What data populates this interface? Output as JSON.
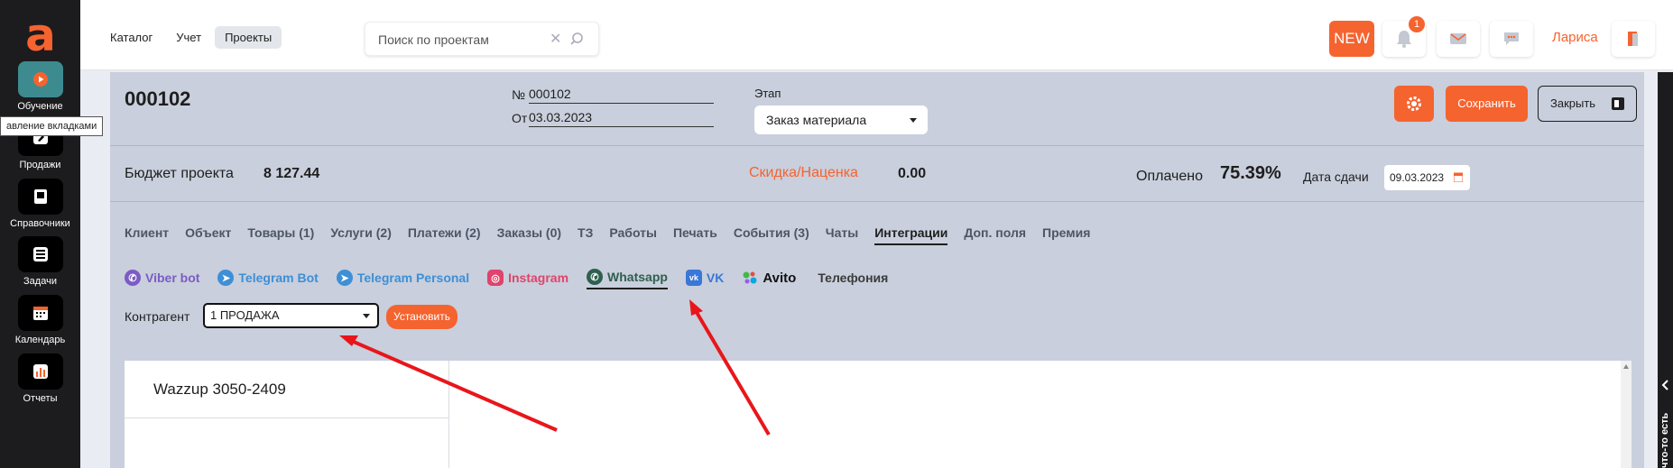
{
  "sidebar": {
    "logo": "a",
    "items": [
      {
        "label": "Обучение",
        "icon": "play-icon",
        "active": true
      },
      {
        "label": "Продажи",
        "icon": "tag-icon"
      },
      {
        "label": "Справочники",
        "icon": "book-icon"
      },
      {
        "label": "Задачи",
        "icon": "list-icon"
      },
      {
        "label": "Календарь",
        "icon": "calendar-icon"
      },
      {
        "label": "Отчеты",
        "icon": "chart-icon"
      }
    ],
    "tooltip": "авление вкладками"
  },
  "topbar": {
    "crumbs": [
      "Каталог",
      "Учет",
      "Проекты"
    ],
    "active_crumb": "Проекты",
    "search_placeholder": "Поиск по проектам",
    "new_label": "NEW",
    "notification_count": "1",
    "user_name": "Лариса"
  },
  "project": {
    "title": "000102",
    "number_label": "№",
    "number": "000102",
    "from_label": "От",
    "date": "03.03.2023",
    "stage_label": "Этап",
    "stage_value": "Заказ материала",
    "save_label": "Сохранить",
    "close_label": "Закрыть"
  },
  "summary": {
    "budget_label": "Бюджет проекта",
    "budget_value": "8 127.44",
    "discount_label": "Скидка/Наценка",
    "discount_value": "0.00",
    "paid_label": "Оплачено",
    "paid_value": "75.39%",
    "due_label": "Дата сдачи",
    "due_date": "09.03.2023"
  },
  "tabs": [
    "Клиент",
    "Объект",
    "Товары (1)",
    "Услуги (2)",
    "Платежи (2)",
    "Заказы (0)",
    "ТЗ",
    "Работы",
    "Печать",
    "События (3)",
    "Чаты",
    "Интеграции",
    "Доп. поля",
    "Премия"
  ],
  "active_tab": "Интеграции",
  "subtabs": [
    {
      "label": "Viber bot",
      "icon": "viber-icon",
      "color": "#7b5cc4"
    },
    {
      "label": "Telegram Bot",
      "icon": "telegram-icon",
      "color": "#3d8fd6"
    },
    {
      "label": "Telegram Personal",
      "icon": "telegram-icon",
      "color": "#3d8fd6"
    },
    {
      "label": "Instagram",
      "icon": "instagram-icon",
      "color": "#e0436b"
    },
    {
      "label": "Whatsapp",
      "icon": "whatsapp-icon",
      "color": "#2f5f4f"
    },
    {
      "label": "VK",
      "icon": "vk-icon",
      "color": "#3a77d8"
    },
    {
      "label": "Avito",
      "icon": "avito-icon",
      "color": "#111111"
    },
    {
      "label": "Телефония",
      "icon": "",
      "color": "#3b3b3b"
    }
  ],
  "active_subtab": "Whatsapp",
  "counterparty": {
    "label": "Контрагент",
    "value": "1 ПРОДАЖА",
    "set_label": "Установить"
  },
  "channels": [
    "Wazzup 3050-2409"
  ],
  "right_panel_label": "что-то есть",
  "colors": {
    "accent": "#f5632f",
    "panel": "#c9cfdc",
    "annotation_arrow": "#e8161b"
  }
}
